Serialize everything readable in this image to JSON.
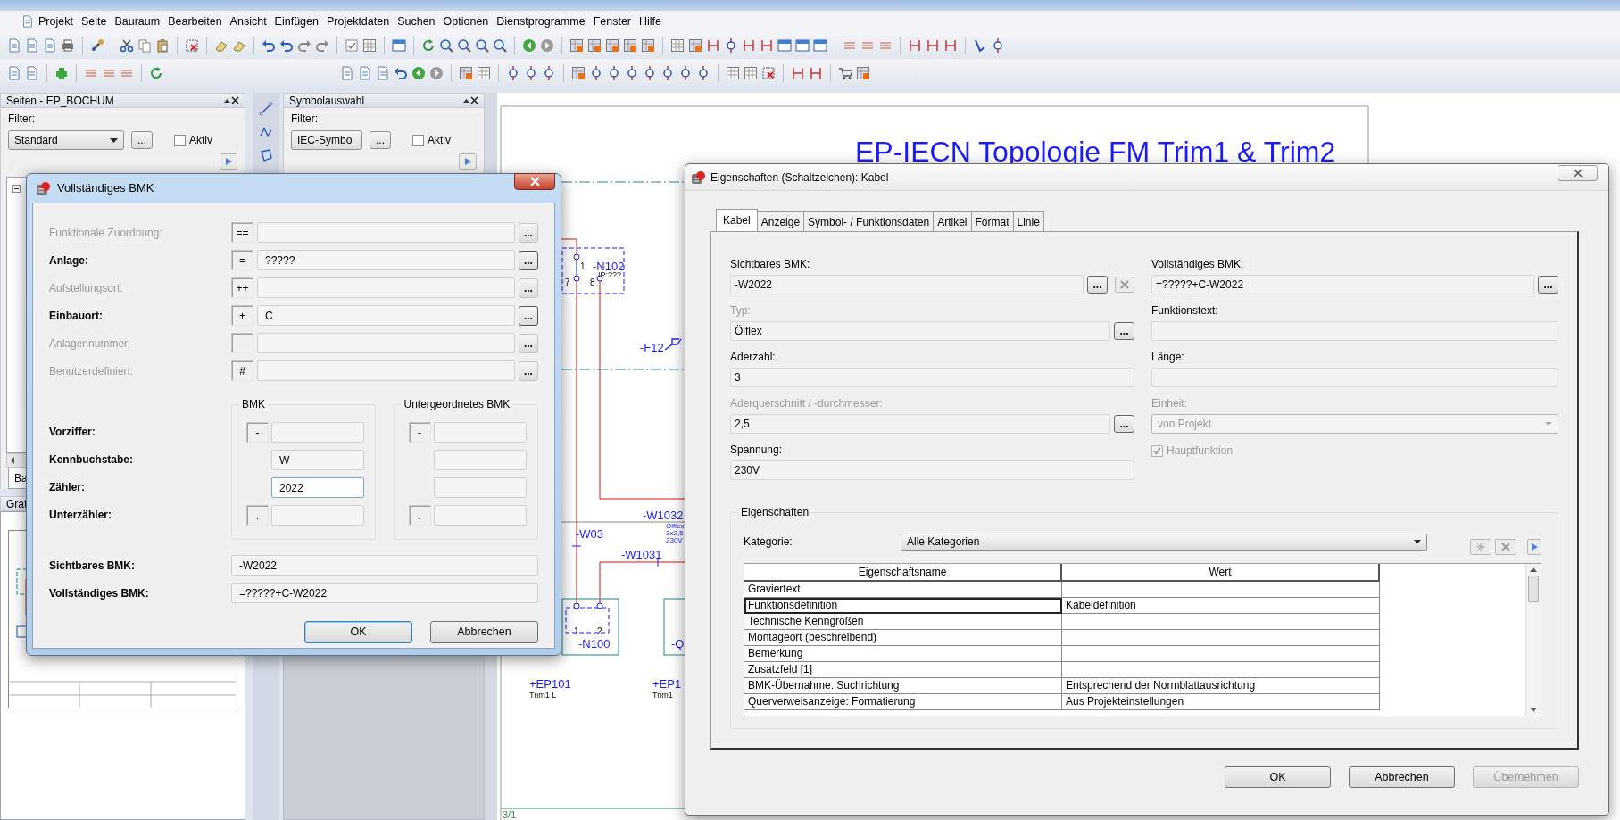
{
  "menu": [
    "Projekt",
    "Seite",
    "Bauraum",
    "Bearbeiten",
    "Ansicht",
    "Einfügen",
    "Projektdaten",
    "Suchen",
    "Optionen",
    "Dienstprogramme",
    "Fenster",
    "Hilfe"
  ],
  "pages_panel": {
    "title": "Seiten - EP_BOCHUM",
    "filter_label": "Filter:",
    "filter_value": "Standard",
    "browse": "...",
    "active": {
      "label": "Aktiv",
      "checked": false
    },
    "tab": "Ba"
  },
  "graphics_panel": {
    "title": "Graf"
  },
  "symbol_panel": {
    "title": "Symbolauswahl",
    "filter_label": "Filter:",
    "filter_value": "IEC-Symbo",
    "browse": "...",
    "active": {
      "label": "Aktiv",
      "checked": false
    }
  },
  "schematic": {
    "title": "EP-IECN Topologie FM Trim1 & Trim2",
    "page": "3/1",
    "labels": [
      {
        "text": "-N102",
        "kind": "designation"
      },
      {
        "text": "IP:???",
        "kind": "note"
      },
      {
        "text": "1",
        "kind": "terminal"
      },
      {
        "text": "7",
        "kind": "terminal"
      },
      {
        "text": "8",
        "kind": "terminal"
      },
      {
        "text": "-F12",
        "kind": "designation"
      },
      {
        "text": "-W1032",
        "kind": "designation"
      },
      {
        "text": "Ölflex",
        "kind": "cable"
      },
      {
        "text": "3x2,5",
        "kind": "cable"
      },
      {
        "text": "230V",
        "kind": "cable"
      },
      {
        "text": "-W03",
        "kind": "designation"
      },
      {
        "text": "-W1031",
        "kind": "designation"
      },
      {
        "text": "1",
        "kind": "terminal"
      },
      {
        "text": "2",
        "kind": "terminal"
      },
      {
        "text": "-N100",
        "kind": "designation"
      },
      {
        "text": "-Q",
        "kind": "designation"
      },
      {
        "text": "+EP101",
        "kind": "designation"
      },
      {
        "text": "Trim1 L",
        "kind": "note"
      },
      {
        "text": "+EP1",
        "kind": "designation"
      },
      {
        "text": "Trim1",
        "kind": "note"
      }
    ]
  },
  "bmk_dialog": {
    "title": "Vollständiges BMK",
    "rows": [
      {
        "label": "Funktionale Zuordnung:",
        "prefix": "==",
        "browse": "...",
        "disabled": true
      },
      {
        "label": "Anlage:",
        "prefix": "=",
        "value": "?????",
        "browse": "...",
        "disabled": false
      },
      {
        "label": "Aufstellungsort:",
        "prefix": "++",
        "browse": "...",
        "disabled": true
      },
      {
        "label": "Einbauort:",
        "prefix": "+",
        "value": "C",
        "browse": "...",
        "disabled": false
      },
      {
        "label": "Anlagennummer:",
        "browse": "...",
        "disabled": true
      },
      {
        "label": "Benutzerdefiniert:",
        "prefix": "#",
        "browse": "...",
        "disabled": true
      }
    ],
    "part_labels": [
      "Vorziffer:",
      "Kennbuchstabe:",
      "Zähler:",
      "Unterzähler:"
    ],
    "groups": [
      {
        "title": "BMK",
        "fields": [
          {
            "prefix": "-",
            "focused": false
          },
          {
            "value": "W",
            "focused": false
          },
          {
            "value": "2022",
            "focused": true
          },
          {
            "prefix": ".",
            "focused": false
          }
        ]
      },
      {
        "title": "Untergeordnetes BMK",
        "fields": [
          {
            "prefix": "-",
            "focused": false
          },
          {
            "focused": false
          },
          {
            "focused": false
          },
          {
            "prefix": ".",
            "focused": false
          }
        ]
      }
    ],
    "results": [
      {
        "label": "Sichtbares BMK:",
        "value": "-W2022"
      },
      {
        "label": "Vollständiges BMK:",
        "value": "=?????+C-W2022"
      }
    ],
    "buttons": [
      {
        "label": "OK",
        "default": true
      },
      {
        "label": "Abbrechen",
        "default": false
      }
    ]
  },
  "properties_dialog": {
    "title": "Eigenschaften (Schaltzeichen): Kabel",
    "tabs": [
      {
        "label": "Kabel",
        "selected": true
      },
      {
        "label": "Anzeige",
        "selected": false
      },
      {
        "label": "Symbol- / Funktionsdaten",
        "selected": false
      },
      {
        "label": "Artikel",
        "selected": false
      },
      {
        "label": "Format",
        "selected": false
      },
      {
        "label": "Linie",
        "selected": false
      }
    ],
    "left_fields": [
      {
        "kind": "text",
        "label": "Sichtbares BMK:",
        "value": "-W2022",
        "browse": "...",
        "clear": true,
        "disabled": false
      },
      {
        "kind": "text",
        "label": "Typ:",
        "value": "Ölflex",
        "browse": "...",
        "disabled": true
      },
      {
        "kind": "text",
        "label": "Aderzahl:",
        "value": "3",
        "disabled": false
      },
      {
        "kind": "text",
        "label": "Aderquerschnitt / -durchmesser:",
        "value": "2,5",
        "browse": "...",
        "disabled": true
      },
      {
        "kind": "text",
        "label": "Spannung:",
        "value": "230V",
        "disabled": false
      }
    ],
    "right_fields": [
      {
        "kind": "text",
        "label": "Vollständiges BMK:",
        "value": "=?????+C-W2022",
        "browse": "...",
        "disabled": false
      },
      {
        "kind": "text",
        "label": "Funktionstext:",
        "disabled": false
      },
      {
        "kind": "text",
        "label": "Länge:",
        "disabled": false
      },
      {
        "kind": "select",
        "label": "Einheit:",
        "value": "von Projekt",
        "disabled": true
      },
      {
        "kind": "checkbox",
        "label": "Hauptfunktion",
        "checked": true,
        "disabled": true
      }
    ],
    "properties": {
      "title": "Eigenschaften",
      "category_label": "Kategorie:",
      "category_value": "Alle Kategorien",
      "columns": [
        "Eigenschaftsname",
        "Wert"
      ],
      "rows": [
        {
          "name": "Graviertext",
          "selected": false
        },
        {
          "name": "Funktionsdefinition",
          "value": "Kabeldefinition",
          "selected": true
        },
        {
          "name": "Technische Kenngrößen",
          "selected": false
        },
        {
          "name": "Montageort (beschreibend)",
          "selected": false
        },
        {
          "name": "Bemerkung",
          "selected": false
        },
        {
          "name": "Zusatzfeld [1]",
          "selected": false
        },
        {
          "name": "BMK-Übernahme: Suchrichtung",
          "value": "Entsprechend der Normblattausrichtung",
          "selected": false
        },
        {
          "name": "Querverweisanzeige: Formatierung",
          "value": "Aus Projekteinstellungen",
          "selected": false
        }
      ]
    },
    "buttons": [
      {
        "label": "OK",
        "disabled": false
      },
      {
        "label": "Abbrechen",
        "disabled": false
      },
      {
        "label": "Übernehmen",
        "disabled": true
      }
    ]
  }
}
